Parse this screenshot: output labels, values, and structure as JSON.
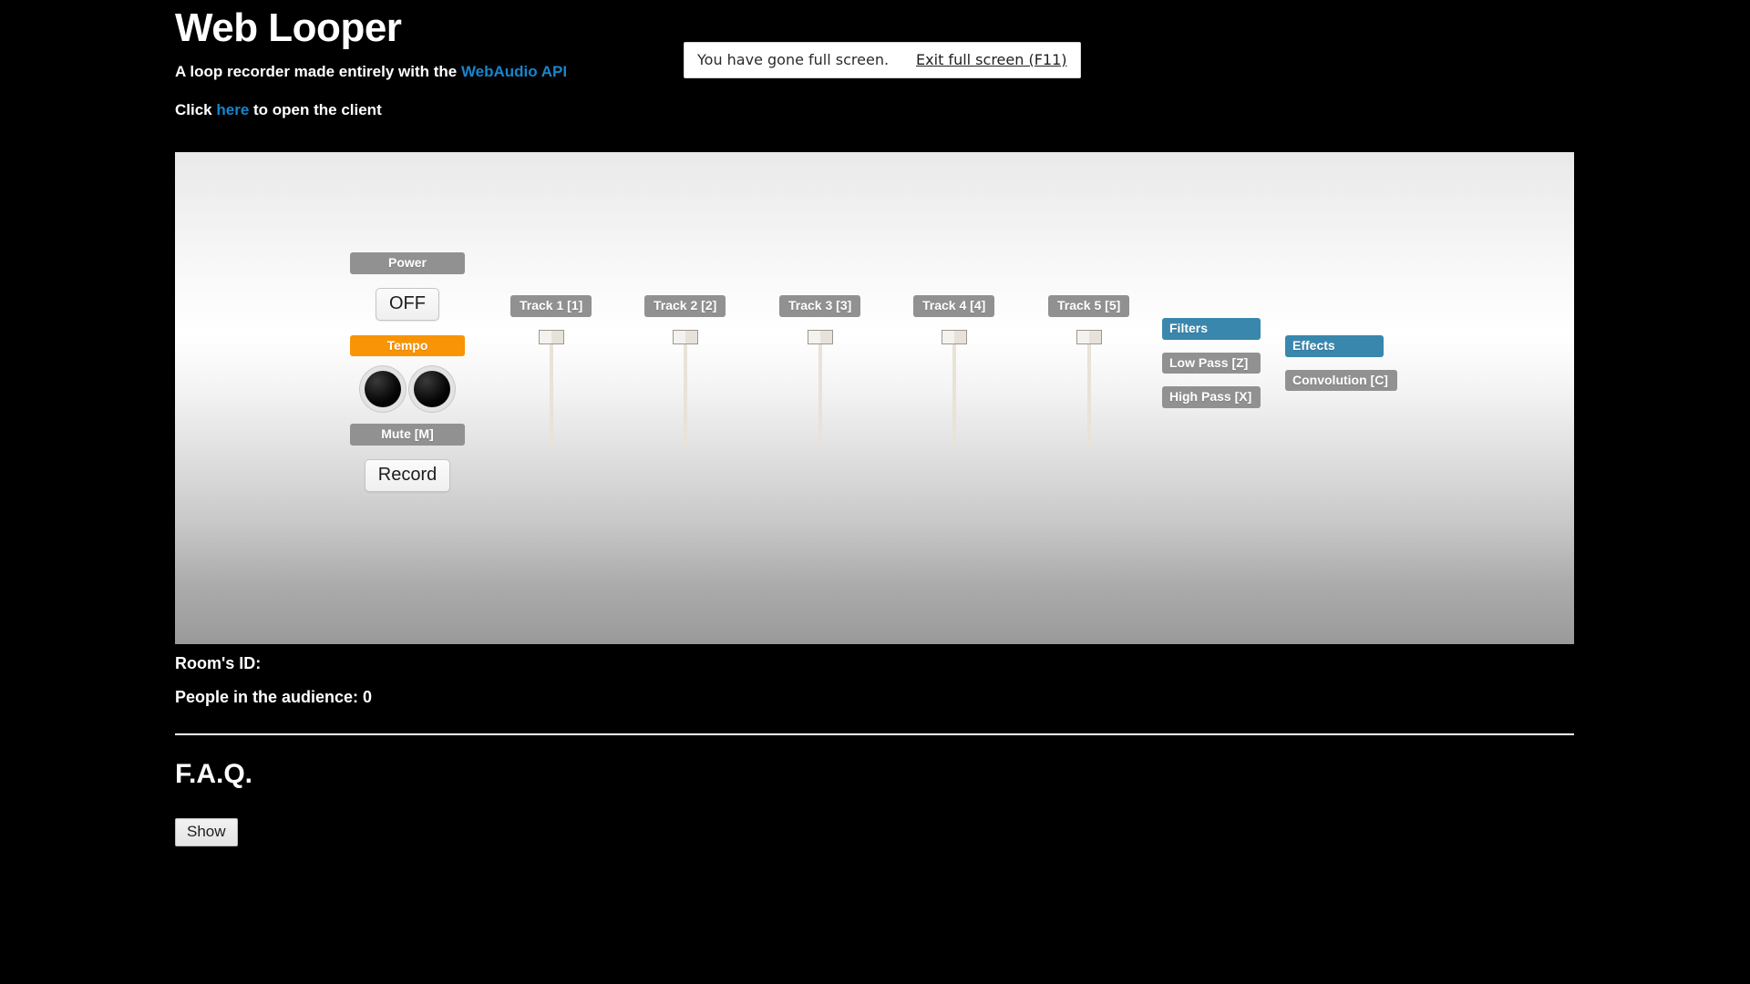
{
  "header": {
    "title": "Web Looper",
    "tagline_prefix": "A loop recorder made entirely with the ",
    "tagline_link": "WebAudio API",
    "client_prefix": "Click ",
    "client_link": "here",
    "client_suffix": " to open the client"
  },
  "fullscreen_notice": {
    "message": "You have gone full screen.",
    "exit_label": "Exit full screen (F11)"
  },
  "mixer": {
    "controls": {
      "power_label": "Power",
      "power_state": "OFF",
      "tempo_label": "Tempo",
      "knob_left": "tempo-knob-left",
      "knob_right": "tempo-knob-right",
      "mute_label": "Mute [M]",
      "record_label": "Record"
    },
    "tracks": [
      {
        "label": "Track 1 [1]"
      },
      {
        "label": "Track 2 [2]"
      },
      {
        "label": "Track 3 [3]"
      },
      {
        "label": "Track 4 [4]"
      },
      {
        "label": "Track 5 [5]"
      }
    ],
    "filters": {
      "header": "Filters",
      "items": [
        "Low Pass [Z]",
        "High Pass [X]"
      ]
    },
    "effects": {
      "header": "Effects",
      "items": [
        "Convolution [C]"
      ]
    }
  },
  "room": {
    "id_label": "Room's ID:",
    "audience_label": "People in the audience: 0"
  },
  "faq": {
    "title": "F.A.Q.",
    "toggle_label": "Show"
  },
  "colors": {
    "background": "#000000",
    "link": "#1785cd",
    "badge_gray": "#919191",
    "badge_orange": "#f89406",
    "badge_blue": "#3a87ad",
    "panel_top": "#ffffff",
    "panel_bottom": "#9a9a9a"
  }
}
